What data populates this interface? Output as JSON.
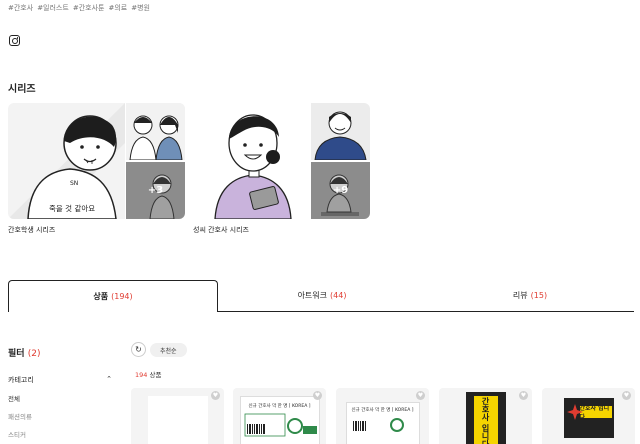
{
  "hashtags": [
    "#간호사",
    "#일러스트",
    "#간호사툰",
    "#의료",
    "#병원"
  ],
  "series": {
    "title": "시리즈",
    "cards": [
      {
        "caption": "간호학생 시리즈",
        "main_text": "SN",
        "main_bubble": "죽을 것 같아요",
        "more": "+3"
      },
      {
        "caption": "성씨 간호사 시리즈",
        "more": "+9"
      }
    ]
  },
  "tabs": [
    {
      "label": "상품",
      "count": "(194)",
      "active": true
    },
    {
      "label": "아트워크",
      "count": "(44)",
      "active": false
    },
    {
      "label": "리뷰",
      "count": "(15)",
      "active": false
    }
  ],
  "filter": {
    "title": "필터",
    "count": "(2)",
    "category_label": "카테고리",
    "items": [
      "전체",
      "패션의류",
      "스티커"
    ]
  },
  "toolbar": {
    "refresh_icon": "↻",
    "sort_label": "추천순"
  },
  "products": {
    "count": "194",
    "count_label": "상품",
    "sticker_label": "신규 간호사 막 한 명 [ KOREA ]",
    "sticker_num": "4000",
    "banner_text": "간호사 입니다"
  },
  "colors": {
    "accent": "#e03c31",
    "purple": "#c9b3dc",
    "navy": "#2f4b8a"
  }
}
